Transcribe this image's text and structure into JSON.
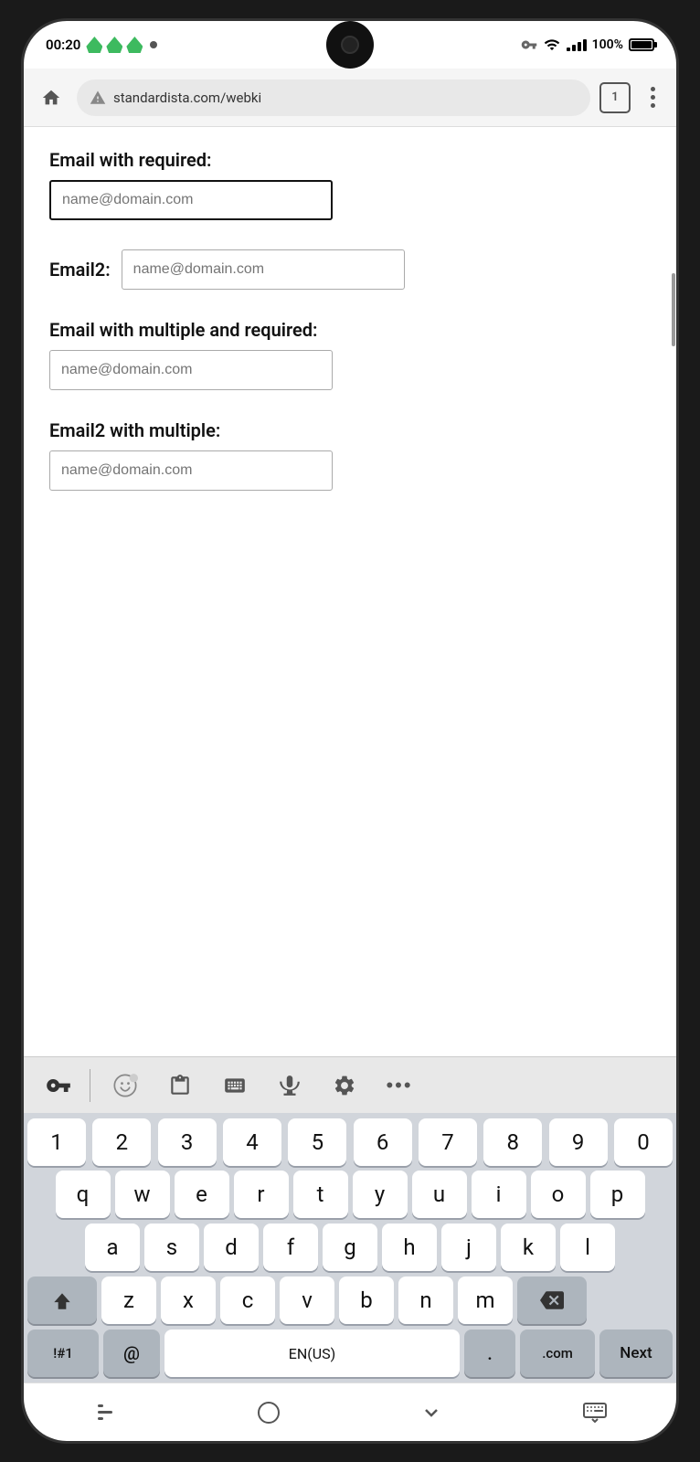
{
  "status_bar": {
    "time": "00:20",
    "battery": "100%",
    "tab_count": "1"
  },
  "browser": {
    "url": "standardista.com/webki"
  },
  "form": {
    "field1_label": "Email with required:",
    "field1_placeholder": "name@domain.com",
    "field2_label": "Email2:",
    "field2_placeholder": "name@domain.com",
    "field3_label": "Email with multiple and required:",
    "field3_placeholder": "name@domain.com",
    "field4_label": "Email2 with multiple:",
    "field4_placeholder": "name@domain.com"
  },
  "keyboard": {
    "num_row": [
      "1",
      "2",
      "3",
      "4",
      "5",
      "6",
      "7",
      "8",
      "9",
      "0"
    ],
    "row1": [
      "q",
      "w",
      "e",
      "r",
      "t",
      "y",
      "u",
      "i",
      "o",
      "p"
    ],
    "row2": [
      "a",
      "s",
      "d",
      "f",
      "g",
      "h",
      "j",
      "k",
      "l"
    ],
    "row3": [
      "z",
      "x",
      "c",
      "v",
      "b",
      "n",
      "m"
    ],
    "special_keys": {
      "shift": "⬆",
      "backspace": "⌫",
      "symbols": "!#1",
      "at": "@",
      "space": "EN(US)",
      "dot": ".",
      "dotcom": ".com",
      "next": "Next"
    }
  }
}
